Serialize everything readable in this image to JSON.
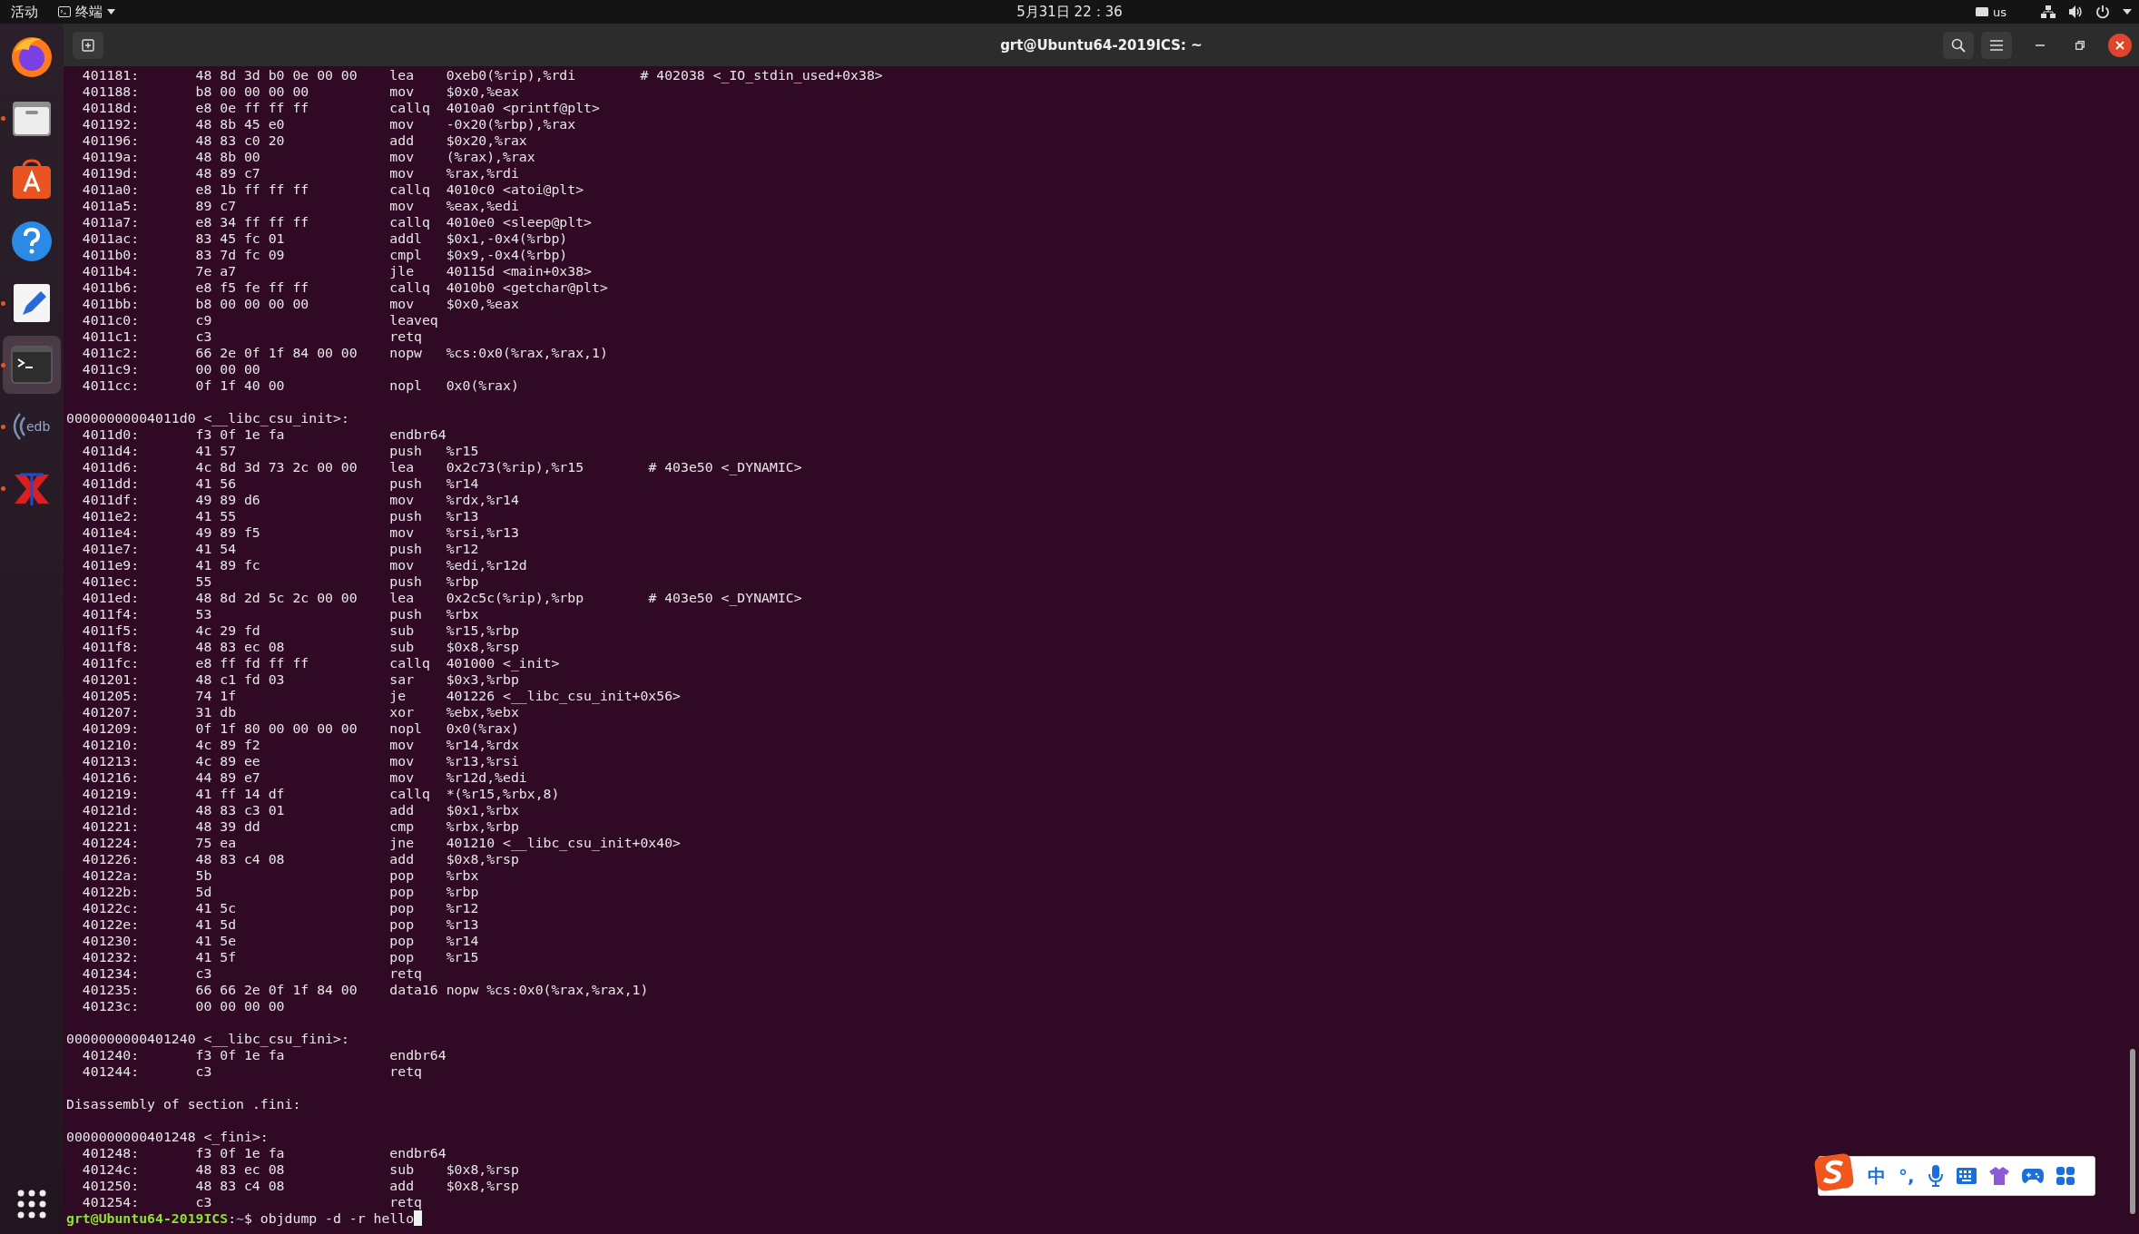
{
  "top_bar": {
    "activities": "活动",
    "app_menu": "终端",
    "clock": "5月31日 22：36",
    "keyboard_layout": "us"
  },
  "dock": {
    "items": [
      {
        "kind": "firefox",
        "running": false,
        "selected": false
      },
      {
        "kind": "files",
        "running": true,
        "selected": false
      },
      {
        "kind": "store",
        "running": false,
        "selected": false
      },
      {
        "kind": "help",
        "running": false,
        "selected": false
      },
      {
        "kind": "editor",
        "running": true,
        "selected": false
      },
      {
        "kind": "terminal",
        "running": true,
        "selected": true
      },
      {
        "kind": "edb",
        "running": true,
        "selected": false
      },
      {
        "kind": "xapp",
        "running": true,
        "selected": false
      }
    ]
  },
  "window": {
    "title": "grt@Ubuntu64-2019ICS: ~"
  },
  "terminal": {
    "lines": [
      {
        "kind": "instr",
        "addr": "401181:",
        "bytes": "48 8d 3d b0 0e 00 00",
        "mnemonic": "lea",
        "operands": "0xeb0(%rip),%rdi",
        "comment": "# 402038 <_IO_stdin_used+0x38>"
      },
      {
        "kind": "instr",
        "addr": "401188:",
        "bytes": "b8 00 00 00 00",
        "mnemonic": "mov",
        "operands": "$0x0,%eax"
      },
      {
        "kind": "instr",
        "addr": "40118d:",
        "bytes": "e8 0e ff ff ff",
        "mnemonic": "callq",
        "operands": "4010a0 <printf@plt>"
      },
      {
        "kind": "instr",
        "addr": "401192:",
        "bytes": "48 8b 45 e0",
        "mnemonic": "mov",
        "operands": "-0x20(%rbp),%rax"
      },
      {
        "kind": "instr",
        "addr": "401196:",
        "bytes": "48 83 c0 20",
        "mnemonic": "add",
        "operands": "$0x20,%rax"
      },
      {
        "kind": "instr",
        "addr": "40119a:",
        "bytes": "48 8b 00",
        "mnemonic": "mov",
        "operands": "(%rax),%rax"
      },
      {
        "kind": "instr",
        "addr": "40119d:",
        "bytes": "48 89 c7",
        "mnemonic": "mov",
        "operands": "%rax,%rdi"
      },
      {
        "kind": "instr",
        "addr": "4011a0:",
        "bytes": "e8 1b ff ff ff",
        "mnemonic": "callq",
        "operands": "4010c0 <atoi@plt>"
      },
      {
        "kind": "instr",
        "addr": "4011a5:",
        "bytes": "89 c7",
        "mnemonic": "mov",
        "operands": "%eax,%edi"
      },
      {
        "kind": "instr",
        "addr": "4011a7:",
        "bytes": "e8 34 ff ff ff",
        "mnemonic": "callq",
        "operands": "4010e0 <sleep@plt>"
      },
      {
        "kind": "instr",
        "addr": "4011ac:",
        "bytes": "83 45 fc 01",
        "mnemonic": "addl",
        "operands": "$0x1,-0x4(%rbp)"
      },
      {
        "kind": "instr",
        "addr": "4011b0:",
        "bytes": "83 7d fc 09",
        "mnemonic": "cmpl",
        "operands": "$0x9,-0x4(%rbp)"
      },
      {
        "kind": "instr",
        "addr": "4011b4:",
        "bytes": "7e a7",
        "mnemonic": "jle",
        "operands": "40115d <main+0x38>"
      },
      {
        "kind": "instr",
        "addr": "4011b6:",
        "bytes": "e8 f5 fe ff ff",
        "mnemonic": "callq",
        "operands": "4010b0 <getchar@plt>"
      },
      {
        "kind": "instr",
        "addr": "4011bb:",
        "bytes": "b8 00 00 00 00",
        "mnemonic": "mov",
        "operands": "$0x0,%eax"
      },
      {
        "kind": "instr",
        "addr": "4011c0:",
        "bytes": "c9",
        "mnemonic": "leaveq"
      },
      {
        "kind": "instr",
        "addr": "4011c1:",
        "bytes": "c3",
        "mnemonic": "retq"
      },
      {
        "kind": "instr",
        "addr": "4011c2:",
        "bytes": "66 2e 0f 1f 84 00 00",
        "mnemonic": "nopw",
        "operands": "%cs:0x0(%rax,%rax,1)"
      },
      {
        "kind": "instr",
        "addr": "4011c9:",
        "bytes": "00 00 00"
      },
      {
        "kind": "instr",
        "addr": "4011cc:",
        "bytes": "0f 1f 40 00",
        "mnemonic": "nopl",
        "operands": "0x0(%rax)"
      },
      {
        "kind": "blank"
      },
      {
        "kind": "text",
        "text": "00000000004011d0 <__libc_csu_init>:"
      },
      {
        "kind": "instr",
        "addr": "4011d0:",
        "bytes": "f3 0f 1e fa",
        "mnemonic": "endbr64"
      },
      {
        "kind": "instr",
        "addr": "4011d4:",
        "bytes": "41 57",
        "mnemonic": "push",
        "operands": "%r15"
      },
      {
        "kind": "instr",
        "addr": "4011d6:",
        "bytes": "4c 8d 3d 73 2c 00 00",
        "mnemonic": "lea",
        "operands": "0x2c73(%rip),%r15",
        "comment": "# 403e50 <_DYNAMIC>"
      },
      {
        "kind": "instr",
        "addr": "4011dd:",
        "bytes": "41 56",
        "mnemonic": "push",
        "operands": "%r14"
      },
      {
        "kind": "instr",
        "addr": "4011df:",
        "bytes": "49 89 d6",
        "mnemonic": "mov",
        "operands": "%rdx,%r14"
      },
      {
        "kind": "instr",
        "addr": "4011e2:",
        "bytes": "41 55",
        "mnemonic": "push",
        "operands": "%r13"
      },
      {
        "kind": "instr",
        "addr": "4011e4:",
        "bytes": "49 89 f5",
        "mnemonic": "mov",
        "operands": "%rsi,%r13"
      },
      {
        "kind": "instr",
        "addr": "4011e7:",
        "bytes": "41 54",
        "mnemonic": "push",
        "operands": "%r12"
      },
      {
        "kind": "instr",
        "addr": "4011e9:",
        "bytes": "41 89 fc",
        "mnemonic": "mov",
        "operands": "%edi,%r12d"
      },
      {
        "kind": "instr",
        "addr": "4011ec:",
        "bytes": "55",
        "mnemonic": "push",
        "operands": "%rbp"
      },
      {
        "kind": "instr",
        "addr": "4011ed:",
        "bytes": "48 8d 2d 5c 2c 00 00",
        "mnemonic": "lea",
        "operands": "0x2c5c(%rip),%rbp",
        "comment": "# 403e50 <_DYNAMIC>"
      },
      {
        "kind": "instr",
        "addr": "4011f4:",
        "bytes": "53",
        "mnemonic": "push",
        "operands": "%rbx"
      },
      {
        "kind": "instr",
        "addr": "4011f5:",
        "bytes": "4c 29 fd",
        "mnemonic": "sub",
        "operands": "%r15,%rbp"
      },
      {
        "kind": "instr",
        "addr": "4011f8:",
        "bytes": "48 83 ec 08",
        "mnemonic": "sub",
        "operands": "$0x8,%rsp"
      },
      {
        "kind": "instr",
        "addr": "4011fc:",
        "bytes": "e8 ff fd ff ff",
        "mnemonic": "callq",
        "operands": "401000 <_init>"
      },
      {
        "kind": "instr",
        "addr": "401201:",
        "bytes": "48 c1 fd 03",
        "mnemonic": "sar",
        "operands": "$0x3,%rbp"
      },
      {
        "kind": "instr",
        "addr": "401205:",
        "bytes": "74 1f",
        "mnemonic": "je",
        "operands": "401226 <__libc_csu_init+0x56>"
      },
      {
        "kind": "instr",
        "addr": "401207:",
        "bytes": "31 db",
        "mnemonic": "xor",
        "operands": "%ebx,%ebx"
      },
      {
        "kind": "instr",
        "addr": "401209:",
        "bytes": "0f 1f 80 00 00 00 00",
        "mnemonic": "nopl",
        "operands": "0x0(%rax)"
      },
      {
        "kind": "instr",
        "addr": "401210:",
        "bytes": "4c 89 f2",
        "mnemonic": "mov",
        "operands": "%r14,%rdx"
      },
      {
        "kind": "instr",
        "addr": "401213:",
        "bytes": "4c 89 ee",
        "mnemonic": "mov",
        "operands": "%r13,%rsi"
      },
      {
        "kind": "instr",
        "addr": "401216:",
        "bytes": "44 89 e7",
        "mnemonic": "mov",
        "operands": "%r12d,%edi"
      },
      {
        "kind": "instr",
        "addr": "401219:",
        "bytes": "41 ff 14 df",
        "mnemonic": "callq",
        "operands": "*(%r15,%rbx,8)"
      },
      {
        "kind": "instr",
        "addr": "40121d:",
        "bytes": "48 83 c3 01",
        "mnemonic": "add",
        "operands": "$0x1,%rbx"
      },
      {
        "kind": "instr",
        "addr": "401221:",
        "bytes": "48 39 dd",
        "mnemonic": "cmp",
        "operands": "%rbx,%rbp"
      },
      {
        "kind": "instr",
        "addr": "401224:",
        "bytes": "75 ea",
        "mnemonic": "jne",
        "operands": "401210 <__libc_csu_init+0x40>"
      },
      {
        "kind": "instr",
        "addr": "401226:",
        "bytes": "48 83 c4 08",
        "mnemonic": "add",
        "operands": "$0x8,%rsp"
      },
      {
        "kind": "instr",
        "addr": "40122a:",
        "bytes": "5b",
        "mnemonic": "pop",
        "operands": "%rbx"
      },
      {
        "kind": "instr",
        "addr": "40122b:",
        "bytes": "5d",
        "mnemonic": "pop",
        "operands": "%rbp"
      },
      {
        "kind": "instr",
        "addr": "40122c:",
        "bytes": "41 5c",
        "mnemonic": "pop",
        "operands": "%r12"
      },
      {
        "kind": "instr",
        "addr": "40122e:",
        "bytes": "41 5d",
        "mnemonic": "pop",
        "operands": "%r13"
      },
      {
        "kind": "instr",
        "addr": "401230:",
        "bytes": "41 5e",
        "mnemonic": "pop",
        "operands": "%r14"
      },
      {
        "kind": "instr",
        "addr": "401232:",
        "bytes": "41 5f",
        "mnemonic": "pop",
        "operands": "%r15"
      },
      {
        "kind": "instr",
        "addr": "401234:",
        "bytes": "c3",
        "mnemonic": "retq"
      },
      {
        "kind": "instr",
        "addr": "401235:",
        "bytes": "66 66 2e 0f 1f 84 00",
        "mnemonic": "data16",
        "operands": "nopw %cs:0x0(%rax,%rax,1)"
      },
      {
        "kind": "instr",
        "addr": "40123c:",
        "bytes": "00 00 00 00"
      },
      {
        "kind": "blank"
      },
      {
        "kind": "text",
        "text": "0000000000401240 <__libc_csu_fini>:"
      },
      {
        "kind": "instr",
        "addr": "401240:",
        "bytes": "f3 0f 1e fa",
        "mnemonic": "endbr64"
      },
      {
        "kind": "instr",
        "addr": "401244:",
        "bytes": "c3",
        "mnemonic": "retq"
      },
      {
        "kind": "blank"
      },
      {
        "kind": "text",
        "text": "Disassembly of section .fini:"
      },
      {
        "kind": "blank"
      },
      {
        "kind": "text",
        "text": "0000000000401248 <_fini>:"
      },
      {
        "kind": "instr",
        "addr": "401248:",
        "bytes": "f3 0f 1e fa",
        "mnemonic": "endbr64"
      },
      {
        "kind": "instr",
        "addr": "40124c:",
        "bytes": "48 83 ec 08",
        "mnemonic": "sub",
        "operands": "$0x8,%rsp"
      },
      {
        "kind": "instr",
        "addr": "401250:",
        "bytes": "48 83 c4 08",
        "mnemonic": "add",
        "operands": "$0x8,%rsp"
      },
      {
        "kind": "instr",
        "addr": "401254:",
        "bytes": "c3",
        "mnemonic": "retq"
      }
    ],
    "prompt": {
      "user_host": "grt@Ubuntu64-2019ICS",
      "separator": ":",
      "path": "~",
      "sign": "$",
      "command": "objdump -d -r hello"
    }
  },
  "ime_toolbar": {
    "mode": "中",
    "punctuation": "°,"
  }
}
